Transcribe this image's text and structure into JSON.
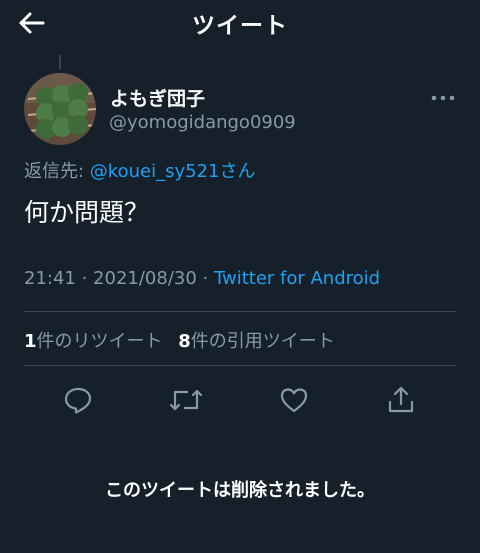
{
  "header": {
    "title": "ツイート"
  },
  "user": {
    "display_name": "よもぎ団子",
    "handle": "@yomogidango0909"
  },
  "reply": {
    "prefix": "返信先: ",
    "mention": "@kouei_sy521",
    "suffix": "さん"
  },
  "tweet": {
    "text": "何か問題？",
    "time": "21:41",
    "separator1": " · ",
    "date": "2021/08/30",
    "separator2": " · ",
    "client": "Twitter for Android"
  },
  "stats": {
    "retweets_count": "1",
    "retweets_label": "件のリツイート",
    "quotes_count": "8",
    "quotes_label": "件の引用ツイート"
  },
  "icons": {
    "back": "arrow-left-icon",
    "more": "more-horizontal-icon",
    "reply": "reply-icon",
    "retweet": "retweet-icon",
    "like": "heart-icon",
    "share": "share-icon"
  },
  "colors": {
    "background": "#15202b",
    "accent": "#1da1f2",
    "secondary_text": "#8899a6",
    "divider": "#38444d"
  },
  "deleted_message": "このツイートは削除されました。"
}
